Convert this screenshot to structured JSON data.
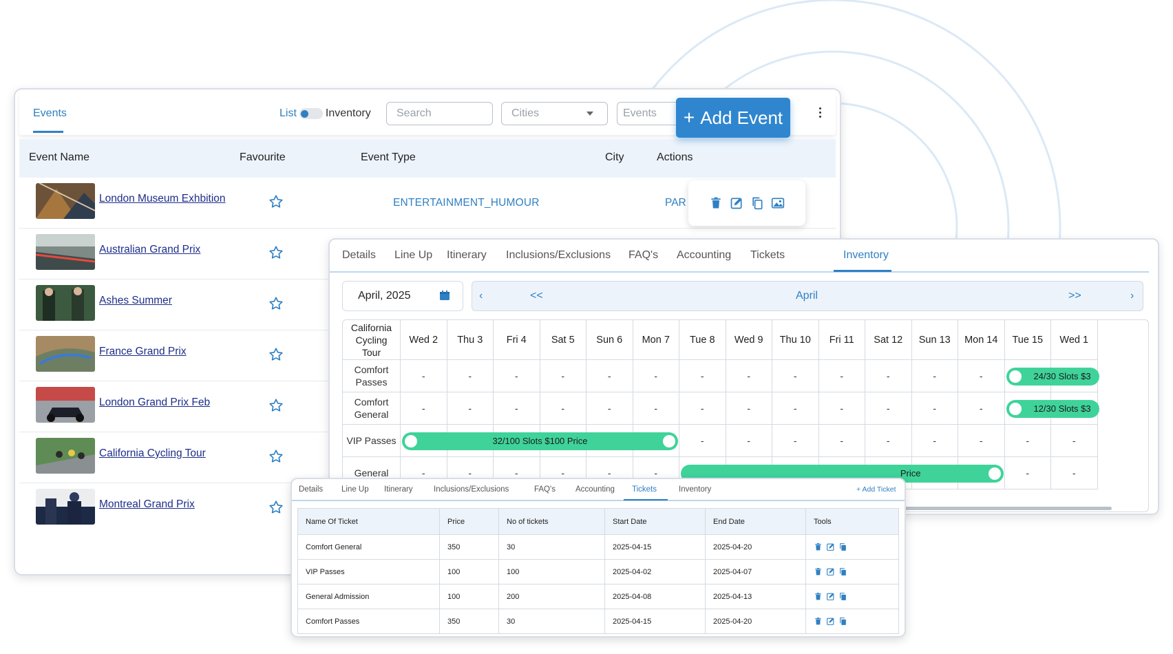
{
  "theme": {
    "accent": "#2f80c3",
    "slot_green": "#3fd39a",
    "header_bg": "#edf3fb",
    "link_navy": "#1d2e8a"
  },
  "events_panel": {
    "tab": "Events",
    "view_toggle": {
      "left": "List",
      "right": "Inventory"
    },
    "search_placeholder": "Search",
    "cities_placeholder": "Cities",
    "events_placeholder": "Events",
    "add_button": {
      "icon": "plus-icon",
      "label": "Add Event"
    },
    "more_icon": "kebab-menu-icon",
    "columns": {
      "name": "Event Name",
      "favourite": "Favourite",
      "type": "Event Type",
      "city": "City",
      "actions": "Actions"
    },
    "rows": [
      {
        "name": "London Museum Exhbition",
        "type": "ENTERTAINMENT_HUMOUR",
        "city": "PAR",
        "favourite": false
      },
      {
        "name": "Australian Grand Prix",
        "type": "",
        "city": "",
        "favourite": false
      },
      {
        "name": "Ashes Summer",
        "type": "",
        "city": "",
        "favourite": false
      },
      {
        "name": "France Grand Prix",
        "type": "",
        "city": "",
        "favourite": false
      },
      {
        "name": "London Grand Prix Feb",
        "type": "",
        "city": "",
        "favourite": false
      },
      {
        "name": "California Cycling Tour",
        "type": "",
        "city": "",
        "favourite": false
      },
      {
        "name": "Montreal Grand Prix",
        "type": "",
        "city": "",
        "favourite": false
      }
    ],
    "action_icons": [
      "trash-icon",
      "edit-icon",
      "copy-icon",
      "image-icon"
    ]
  },
  "inventory_panel": {
    "tabs": [
      "Details",
      "Line Up",
      "Itinerary",
      "Inclusions/Exclusions",
      "FAQ's",
      "Accounting",
      "Tickets",
      "Inventory"
    ],
    "active_tab": "Inventory",
    "date_value": "April, 2025",
    "month_nav": {
      "prev": "‹",
      "prev_fast": "<<",
      "month": "April",
      "next_fast": ">>",
      "next": "›"
    },
    "corner_label": "California Cycling Tour",
    "days": [
      "Wed 2",
      "Thu 3",
      "Fri 4",
      "Sat 5",
      "Sun 6",
      "Mon 7",
      "Tue 8",
      "Wed 9",
      "Thu 10",
      "Fri 11",
      "Sat 12",
      "Sun 13",
      "Mon 14",
      "Tue 15",
      "Wed 1"
    ],
    "rows": [
      "Comfort Passes",
      "Comfort General",
      "VIP Passes",
      "General"
    ],
    "empty_cell": "-",
    "bars": [
      {
        "row": 0,
        "label": "24/30 Slots $3"
      },
      {
        "row": 1,
        "label": "12/30 Slots $3"
      },
      {
        "row": 2,
        "label": "32/100 Slots $100 Price"
      },
      {
        "row": 3,
        "label": "Price"
      }
    ]
  },
  "tickets_panel": {
    "tabs": [
      "Details",
      "Line Up",
      "Itinerary",
      "Inclusions/Exclusions",
      "FAQ's",
      "Accounting",
      "Tickets",
      "Inventory"
    ],
    "active_tab": "Tickets",
    "add_ticket": "+ Add Ticket",
    "columns": [
      "Name Of Ticket",
      "Price",
      "No of tickets",
      "Start Date",
      "End Date",
      "Tools"
    ],
    "rows": [
      {
        "name": "Comfort General",
        "price": "350",
        "count": "30",
        "start": "2025-04-15",
        "end": "2025-04-20"
      },
      {
        "name": "VIP Passes",
        "price": "100",
        "count": "100",
        "start": "2025-04-02",
        "end": "2025-04-07"
      },
      {
        "name": "General Admission",
        "price": "100",
        "count": "200",
        "start": "2025-04-08",
        "end": "2025-04-13"
      },
      {
        "name": "Comfort Passes",
        "price": "350",
        "count": "30",
        "start": "2025-04-15",
        "end": "2025-04-20"
      }
    ]
  }
}
